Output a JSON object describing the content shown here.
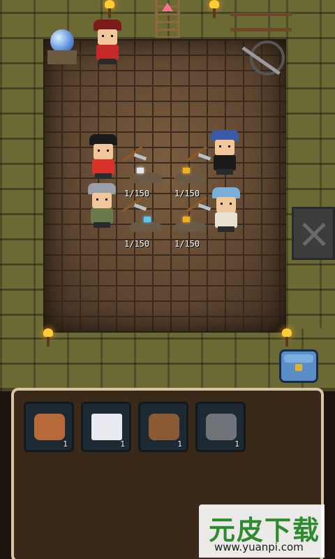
{
  "mining_spots": [
    {
      "counter": "1/150",
      "gem_color": "#e8e8f0"
    },
    {
      "counter": "1/150",
      "gem_color": "#f0b020"
    },
    {
      "counter": "1/150",
      "gem_color": "#5ac8f0"
    },
    {
      "counter": "1/150",
      "gem_color": "#f0b020"
    }
  ],
  "inventory": {
    "items": [
      {
        "name": "wood-log",
        "count": "1",
        "color": "#b8693a"
      },
      {
        "name": "silver-ingot",
        "count": "1",
        "color": "#e8eaf0"
      },
      {
        "name": "leather-bag",
        "count": "1",
        "color": "#8a5a34"
      },
      {
        "name": "stone",
        "count": "1",
        "color": "#707478"
      }
    ]
  },
  "watermark": {
    "title": "元皮下载",
    "url": "www.yuanpi.com"
  },
  "colors": {
    "wall": "#6b6a35",
    "floor": "#6a5038",
    "panel_bg": "#3a2818",
    "panel_border": "#d8c7a6",
    "slot_bg": "#1e2a33"
  }
}
